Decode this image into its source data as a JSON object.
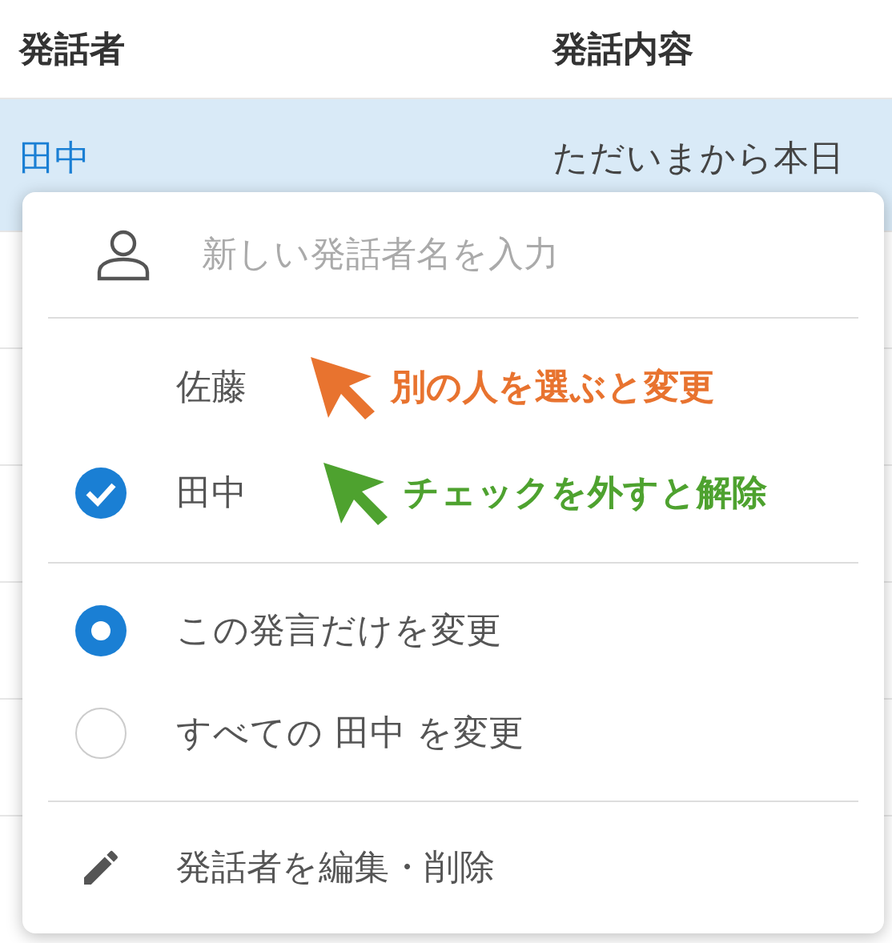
{
  "table": {
    "columns": [
      "発話者",
      "発話内容"
    ],
    "rows": [
      {
        "speaker": "田中",
        "content": "ただいまから本日",
        "selected": true
      }
    ]
  },
  "menu": {
    "input": {
      "placeholder": "新しい発話者名を入力"
    },
    "speakers": [
      {
        "name": "佐藤",
        "checked": false
      },
      {
        "name": "田中",
        "checked": true
      }
    ],
    "scope_options": [
      {
        "label": "この発言だけを変更",
        "selected": true
      },
      {
        "label": "すべての 田中 を変更",
        "selected": false
      }
    ],
    "edit_action": "発話者を編集・削除"
  },
  "annotations": [
    {
      "text": "別の人を選ぶと変更",
      "color": "#e8732f"
    },
    {
      "text": "チェックを外すと解除",
      "color": "#4ea22f"
    }
  ]
}
